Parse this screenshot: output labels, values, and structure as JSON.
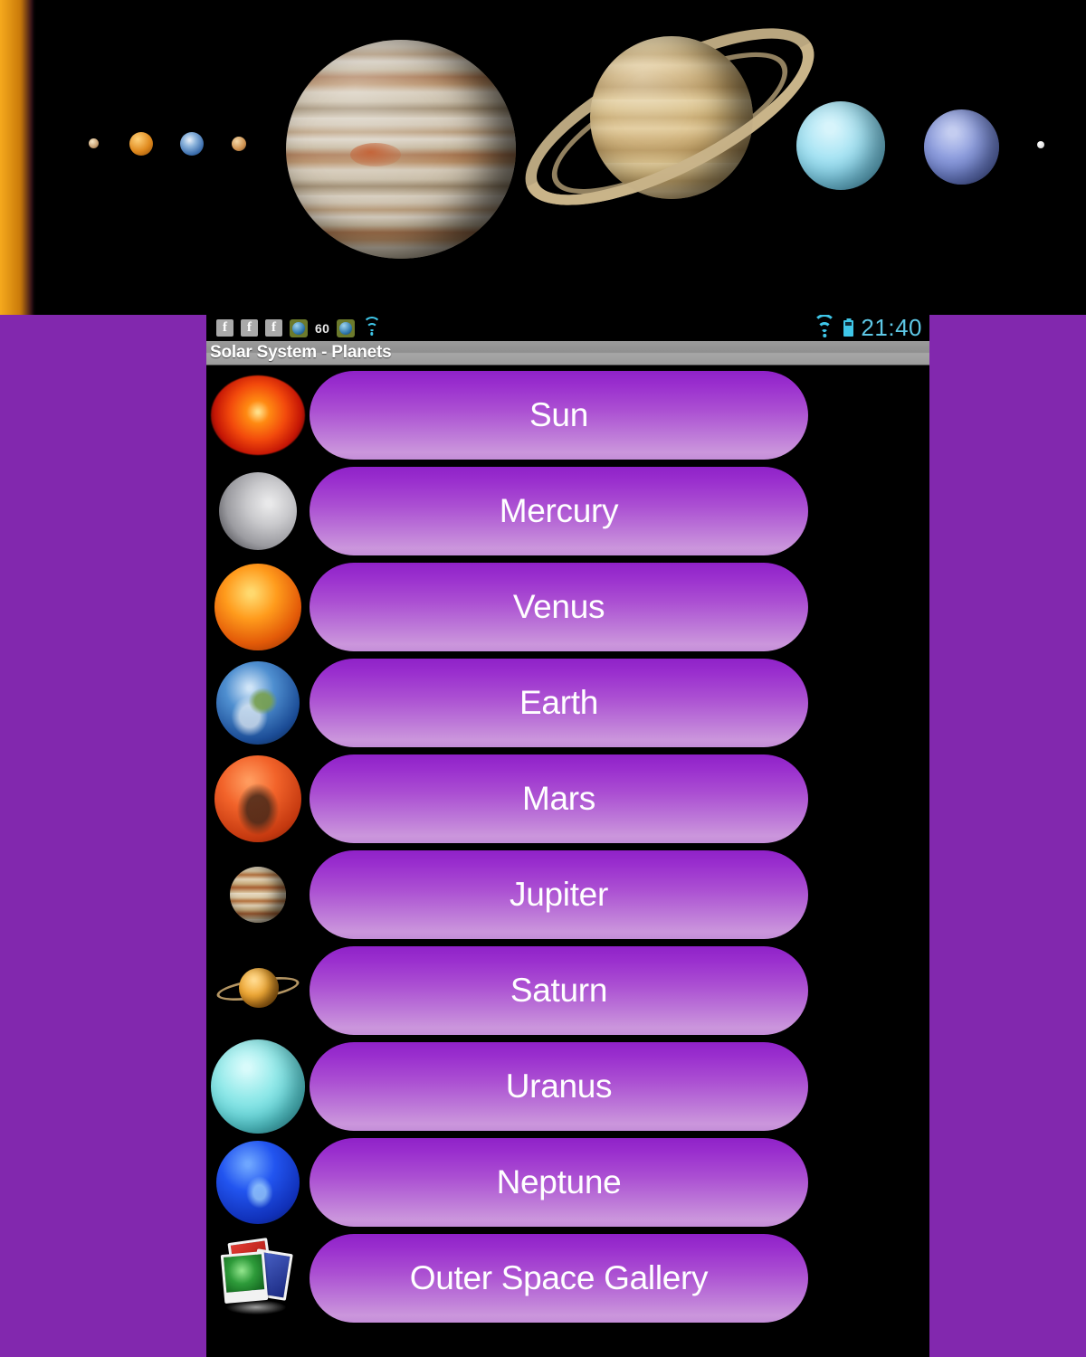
{
  "banner": {
    "alt": "solar-system-lineup",
    "bodies": [
      {
        "name": "Sun",
        "icon": "sun-edge-glyph"
      },
      {
        "name": "Mercury",
        "icon": "mercury-glyph"
      },
      {
        "name": "Venus",
        "icon": "venus-glyph"
      },
      {
        "name": "Earth",
        "icon": "earth-glyph"
      },
      {
        "name": "Mars",
        "icon": "mars-glyph"
      },
      {
        "name": "Jupiter",
        "icon": "jupiter-glyph"
      },
      {
        "name": "Saturn",
        "icon": "saturn-glyph"
      },
      {
        "name": "Uranus",
        "icon": "uranus-glyph"
      },
      {
        "name": "Neptune",
        "icon": "neptune-glyph"
      },
      {
        "name": "Pluto",
        "icon": "pluto-glyph"
      }
    ]
  },
  "page": {
    "background_color": "#8228AE"
  },
  "statusbar": {
    "left_icons": [
      {
        "name": "facebook-notification-icon",
        "label": "f"
      },
      {
        "name": "facebook-notification-icon",
        "label": "f"
      },
      {
        "name": "facebook-notification-icon",
        "label": "f"
      },
      {
        "name": "app-sphere-icon",
        "label": ""
      },
      {
        "name": "notification-count",
        "label": "60"
      },
      {
        "name": "app-sphere-icon",
        "label": ""
      },
      {
        "name": "wifi-notification-icon",
        "label": ""
      }
    ],
    "count": "60",
    "wifi": "wifi-icon",
    "battery": "battery-icon",
    "time": "21:40",
    "time_color": "#5ec8e6",
    "accent_color": "#3fc6e8"
  },
  "titlebar": {
    "title": "Solar System - Planets"
  },
  "list": {
    "button_gradient_top": "#8f22c8",
    "button_gradient_bottom": "#c48ed8",
    "items": [
      {
        "label": "Sun",
        "icon": "sun-icon"
      },
      {
        "label": "Mercury",
        "icon": "mercury-icon"
      },
      {
        "label": "Venus",
        "icon": "venus-icon"
      },
      {
        "label": "Earth",
        "icon": "earth-icon"
      },
      {
        "label": "Mars",
        "icon": "mars-icon"
      },
      {
        "label": "Jupiter",
        "icon": "jupiter-icon"
      },
      {
        "label": "Saturn",
        "icon": "saturn-icon"
      },
      {
        "label": "Uranus",
        "icon": "uranus-icon"
      },
      {
        "label": "Neptune",
        "icon": "neptune-icon"
      },
      {
        "label": "Outer Space Gallery",
        "icon": "gallery-icon"
      }
    ]
  }
}
